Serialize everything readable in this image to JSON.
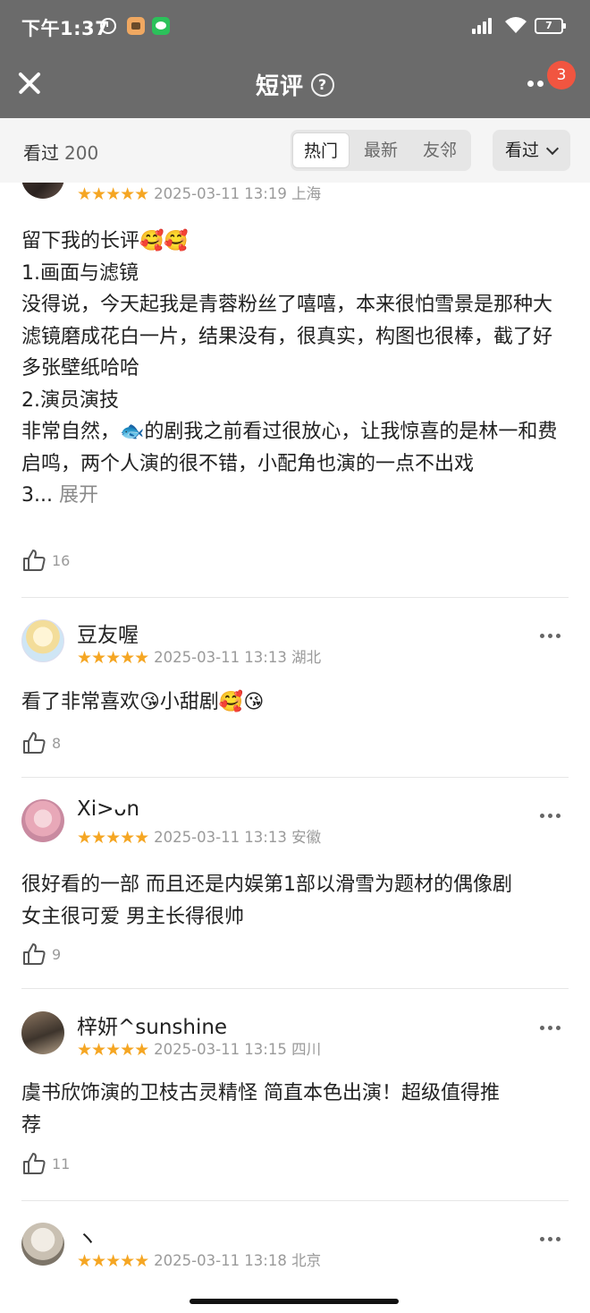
{
  "status": {
    "time": "下午1:37",
    "battery": "7"
  },
  "header": {
    "title": "短评",
    "help": "?",
    "badge": "3"
  },
  "filter": {
    "seen_label": "看过",
    "seen_count": "200",
    "tabs": [
      "热门",
      "最新",
      "友邻"
    ],
    "active_tab": "热门",
    "dropdown": "看过"
  },
  "colors": {
    "star": "#f5a623",
    "badge": "#f15540",
    "header_bg": "#6b6b6b"
  },
  "comments": [
    {
      "user": "",
      "stars": "★★★★★",
      "time": "2025-03-11 13:19",
      "location": "上海",
      "text": "留下我的长评🥰🥰\n1.画面与滤镜\n没得说，今天起我是青蓉粉丝了嘻嘻，本来很怕雪景是那种大滤镜磨成花白一片，结果没有，很真实，构图也很棒，截了好多张壁纸哈哈\n2.演员演技\n非常自然，🐟的剧我之前看过很放心，让我惊喜的是林一和费启鸣，两个人演的很不错，小配角也演的一点不出戏\n3...",
      "expand": " 展开",
      "likes": "16"
    },
    {
      "user": "豆友喔",
      "stars": "★★★★★",
      "time": "2025-03-11 13:13",
      "location": "湖北",
      "text": "看了非常喜欢😘小甜剧🥰😘",
      "likes": "8"
    },
    {
      "user": "Xi>ᴗn",
      "stars": "★★★★★",
      "time": "2025-03-11 13:13",
      "location": "安徽",
      "text": "很好看的一部 而且还是内娱第1部以滑雪为题材的偶像剧\n女主很可爱 男主长得很帅",
      "likes": "9"
    },
    {
      "user": "梓妍^sunshine",
      "stars": "★★★★★",
      "time": "2025-03-11 13:15",
      "location": "四川",
      "text": "虞书欣饰演的卫枝古灵精怪 简直本色出演！超级值得推\n荐",
      "likes": "11"
    },
    {
      "user": "ヽ",
      "stars": "★★★★★",
      "time": "2025-03-11 13:18",
      "location": "北京"
    }
  ]
}
